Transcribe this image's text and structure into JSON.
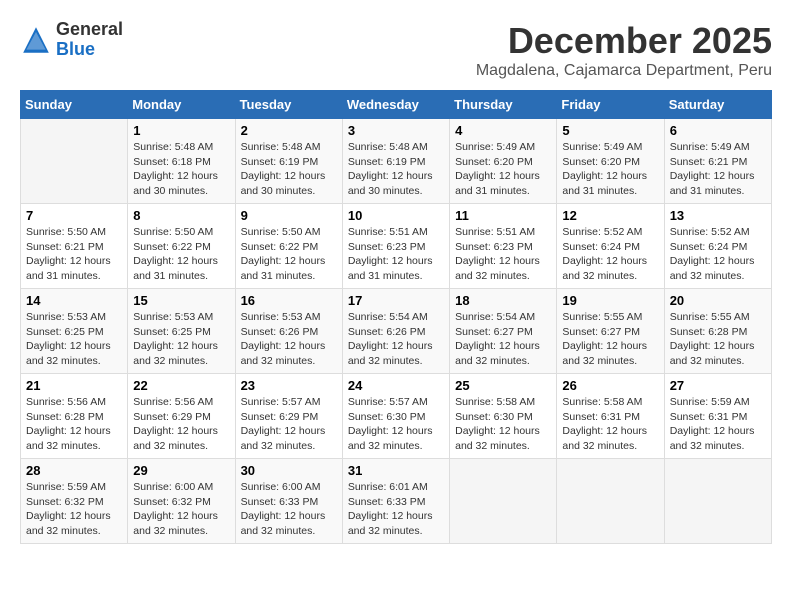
{
  "header": {
    "logo_general": "General",
    "logo_blue": "Blue",
    "month_title": "December 2025",
    "location": "Magdalena, Cajamarca Department, Peru"
  },
  "days_of_week": [
    "Sunday",
    "Monday",
    "Tuesday",
    "Wednesday",
    "Thursday",
    "Friday",
    "Saturday"
  ],
  "weeks": [
    [
      {
        "day": "",
        "sunrise": "",
        "sunset": "",
        "daylight": ""
      },
      {
        "day": "1",
        "sunrise": "Sunrise: 5:48 AM",
        "sunset": "Sunset: 6:18 PM",
        "daylight": "Daylight: 12 hours and 30 minutes."
      },
      {
        "day": "2",
        "sunrise": "Sunrise: 5:48 AM",
        "sunset": "Sunset: 6:19 PM",
        "daylight": "Daylight: 12 hours and 30 minutes."
      },
      {
        "day": "3",
        "sunrise": "Sunrise: 5:48 AM",
        "sunset": "Sunset: 6:19 PM",
        "daylight": "Daylight: 12 hours and 30 minutes."
      },
      {
        "day": "4",
        "sunrise": "Sunrise: 5:49 AM",
        "sunset": "Sunset: 6:20 PM",
        "daylight": "Daylight: 12 hours and 31 minutes."
      },
      {
        "day": "5",
        "sunrise": "Sunrise: 5:49 AM",
        "sunset": "Sunset: 6:20 PM",
        "daylight": "Daylight: 12 hours and 31 minutes."
      },
      {
        "day": "6",
        "sunrise": "Sunrise: 5:49 AM",
        "sunset": "Sunset: 6:21 PM",
        "daylight": "Daylight: 12 hours and 31 minutes."
      }
    ],
    [
      {
        "day": "7",
        "sunrise": "Sunrise: 5:50 AM",
        "sunset": "Sunset: 6:21 PM",
        "daylight": "Daylight: 12 hours and 31 minutes."
      },
      {
        "day": "8",
        "sunrise": "Sunrise: 5:50 AM",
        "sunset": "Sunset: 6:22 PM",
        "daylight": "Daylight: 12 hours and 31 minutes."
      },
      {
        "day": "9",
        "sunrise": "Sunrise: 5:50 AM",
        "sunset": "Sunset: 6:22 PM",
        "daylight": "Daylight: 12 hours and 31 minutes."
      },
      {
        "day": "10",
        "sunrise": "Sunrise: 5:51 AM",
        "sunset": "Sunset: 6:23 PM",
        "daylight": "Daylight: 12 hours and 31 minutes."
      },
      {
        "day": "11",
        "sunrise": "Sunrise: 5:51 AM",
        "sunset": "Sunset: 6:23 PM",
        "daylight": "Daylight: 12 hours and 32 minutes."
      },
      {
        "day": "12",
        "sunrise": "Sunrise: 5:52 AM",
        "sunset": "Sunset: 6:24 PM",
        "daylight": "Daylight: 12 hours and 32 minutes."
      },
      {
        "day": "13",
        "sunrise": "Sunrise: 5:52 AM",
        "sunset": "Sunset: 6:24 PM",
        "daylight": "Daylight: 12 hours and 32 minutes."
      }
    ],
    [
      {
        "day": "14",
        "sunrise": "Sunrise: 5:53 AM",
        "sunset": "Sunset: 6:25 PM",
        "daylight": "Daylight: 12 hours and 32 minutes."
      },
      {
        "day": "15",
        "sunrise": "Sunrise: 5:53 AM",
        "sunset": "Sunset: 6:25 PM",
        "daylight": "Daylight: 12 hours and 32 minutes."
      },
      {
        "day": "16",
        "sunrise": "Sunrise: 5:53 AM",
        "sunset": "Sunset: 6:26 PM",
        "daylight": "Daylight: 12 hours and 32 minutes."
      },
      {
        "day": "17",
        "sunrise": "Sunrise: 5:54 AM",
        "sunset": "Sunset: 6:26 PM",
        "daylight": "Daylight: 12 hours and 32 minutes."
      },
      {
        "day": "18",
        "sunrise": "Sunrise: 5:54 AM",
        "sunset": "Sunset: 6:27 PM",
        "daylight": "Daylight: 12 hours and 32 minutes."
      },
      {
        "day": "19",
        "sunrise": "Sunrise: 5:55 AM",
        "sunset": "Sunset: 6:27 PM",
        "daylight": "Daylight: 12 hours and 32 minutes."
      },
      {
        "day": "20",
        "sunrise": "Sunrise: 5:55 AM",
        "sunset": "Sunset: 6:28 PM",
        "daylight": "Daylight: 12 hours and 32 minutes."
      }
    ],
    [
      {
        "day": "21",
        "sunrise": "Sunrise: 5:56 AM",
        "sunset": "Sunset: 6:28 PM",
        "daylight": "Daylight: 12 hours and 32 minutes."
      },
      {
        "day": "22",
        "sunrise": "Sunrise: 5:56 AM",
        "sunset": "Sunset: 6:29 PM",
        "daylight": "Daylight: 12 hours and 32 minutes."
      },
      {
        "day": "23",
        "sunrise": "Sunrise: 5:57 AM",
        "sunset": "Sunset: 6:29 PM",
        "daylight": "Daylight: 12 hours and 32 minutes."
      },
      {
        "day": "24",
        "sunrise": "Sunrise: 5:57 AM",
        "sunset": "Sunset: 6:30 PM",
        "daylight": "Daylight: 12 hours and 32 minutes."
      },
      {
        "day": "25",
        "sunrise": "Sunrise: 5:58 AM",
        "sunset": "Sunset: 6:30 PM",
        "daylight": "Daylight: 12 hours and 32 minutes."
      },
      {
        "day": "26",
        "sunrise": "Sunrise: 5:58 AM",
        "sunset": "Sunset: 6:31 PM",
        "daylight": "Daylight: 12 hours and 32 minutes."
      },
      {
        "day": "27",
        "sunrise": "Sunrise: 5:59 AM",
        "sunset": "Sunset: 6:31 PM",
        "daylight": "Daylight: 12 hours and 32 minutes."
      }
    ],
    [
      {
        "day": "28",
        "sunrise": "Sunrise: 5:59 AM",
        "sunset": "Sunset: 6:32 PM",
        "daylight": "Daylight: 12 hours and 32 minutes."
      },
      {
        "day": "29",
        "sunrise": "Sunrise: 6:00 AM",
        "sunset": "Sunset: 6:32 PM",
        "daylight": "Daylight: 12 hours and 32 minutes."
      },
      {
        "day": "30",
        "sunrise": "Sunrise: 6:00 AM",
        "sunset": "Sunset: 6:33 PM",
        "daylight": "Daylight: 12 hours and 32 minutes."
      },
      {
        "day": "31",
        "sunrise": "Sunrise: 6:01 AM",
        "sunset": "Sunset: 6:33 PM",
        "daylight": "Daylight: 12 hours and 32 minutes."
      },
      {
        "day": "",
        "sunrise": "",
        "sunset": "",
        "daylight": ""
      },
      {
        "day": "",
        "sunrise": "",
        "sunset": "",
        "daylight": ""
      },
      {
        "day": "",
        "sunrise": "",
        "sunset": "",
        "daylight": ""
      }
    ]
  ]
}
